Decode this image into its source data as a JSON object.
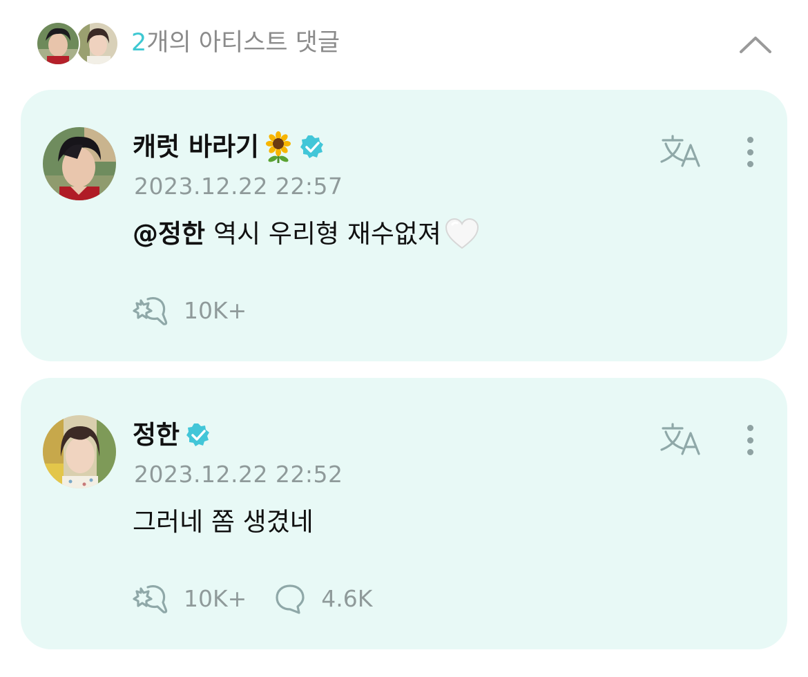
{
  "header": {
    "count": "2",
    "title_suffix": "개의 아티스트 댓글",
    "collapse_icon": "chevron-up-icon"
  },
  "colors": {
    "accent": "#3ec8d2",
    "card_background": "#e8f9f6",
    "muted_text": "#8f9a9a"
  },
  "comments": [
    {
      "author": "캐럿 바라기",
      "author_emoji": "sunflower-icon",
      "verified": true,
      "timestamp": "2023.12.22 22:57",
      "mention": "@정한",
      "text": "역시 우리형 재수없져",
      "trailing_emoji": "white-heart-icon",
      "likes": "10K+",
      "replies": null
    },
    {
      "author": "정한",
      "verified": true,
      "timestamp": "2023.12.22 22:52",
      "mention": null,
      "text": "그러네 쫌 생겼네",
      "likes": "10K+",
      "replies": "4.6K"
    }
  ]
}
